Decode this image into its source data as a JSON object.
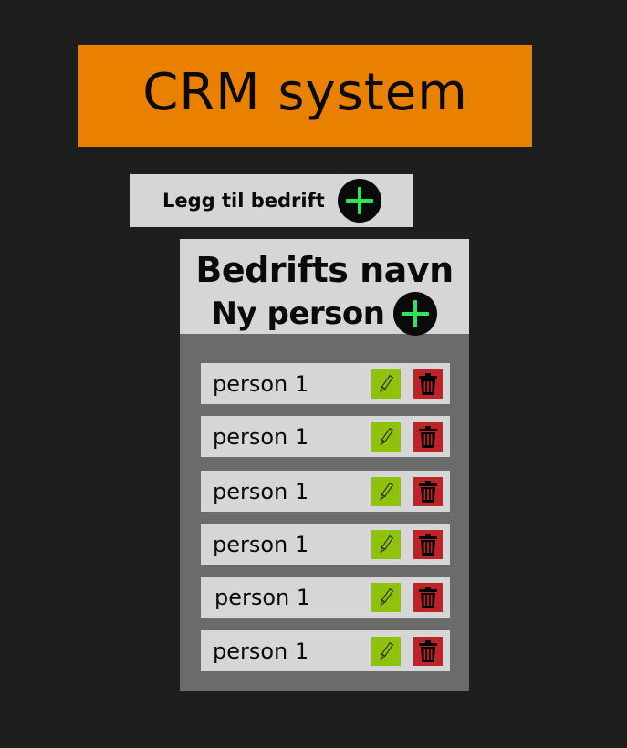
{
  "header": {
    "title": "CRM system",
    "color": "#e98000"
  },
  "add_company": {
    "label": "Legg til bedrift",
    "icon": "plus-circle-icon"
  },
  "company": {
    "name": "Bedrifts navn",
    "new_person_label": "Ny person",
    "new_person_icon": "plus-circle-icon"
  },
  "persons": [
    {
      "name": "person 1",
      "edit_icon": "pencil-icon",
      "delete_icon": "trash-icon"
    },
    {
      "name": "person 1",
      "edit_icon": "pencil-icon",
      "delete_icon": "trash-icon"
    },
    {
      "name": "person 1",
      "edit_icon": "pencil-icon",
      "delete_icon": "trash-icon"
    },
    {
      "name": "person 1",
      "edit_icon": "pencil-icon",
      "delete_icon": "trash-icon"
    },
    {
      "name": "person 1",
      "edit_icon": "pencil-icon",
      "delete_icon": "trash-icon"
    },
    {
      "name": "person 1",
      "edit_icon": "pencil-icon",
      "delete_icon": "trash-icon"
    }
  ],
  "colors": {
    "background": "#1e1e1e",
    "panel": "#d6d6d6",
    "card": "#6b6b6b",
    "plus_green": "#2ee55a",
    "edit_green": "#8ec20b",
    "delete_red": "#be2427"
  }
}
